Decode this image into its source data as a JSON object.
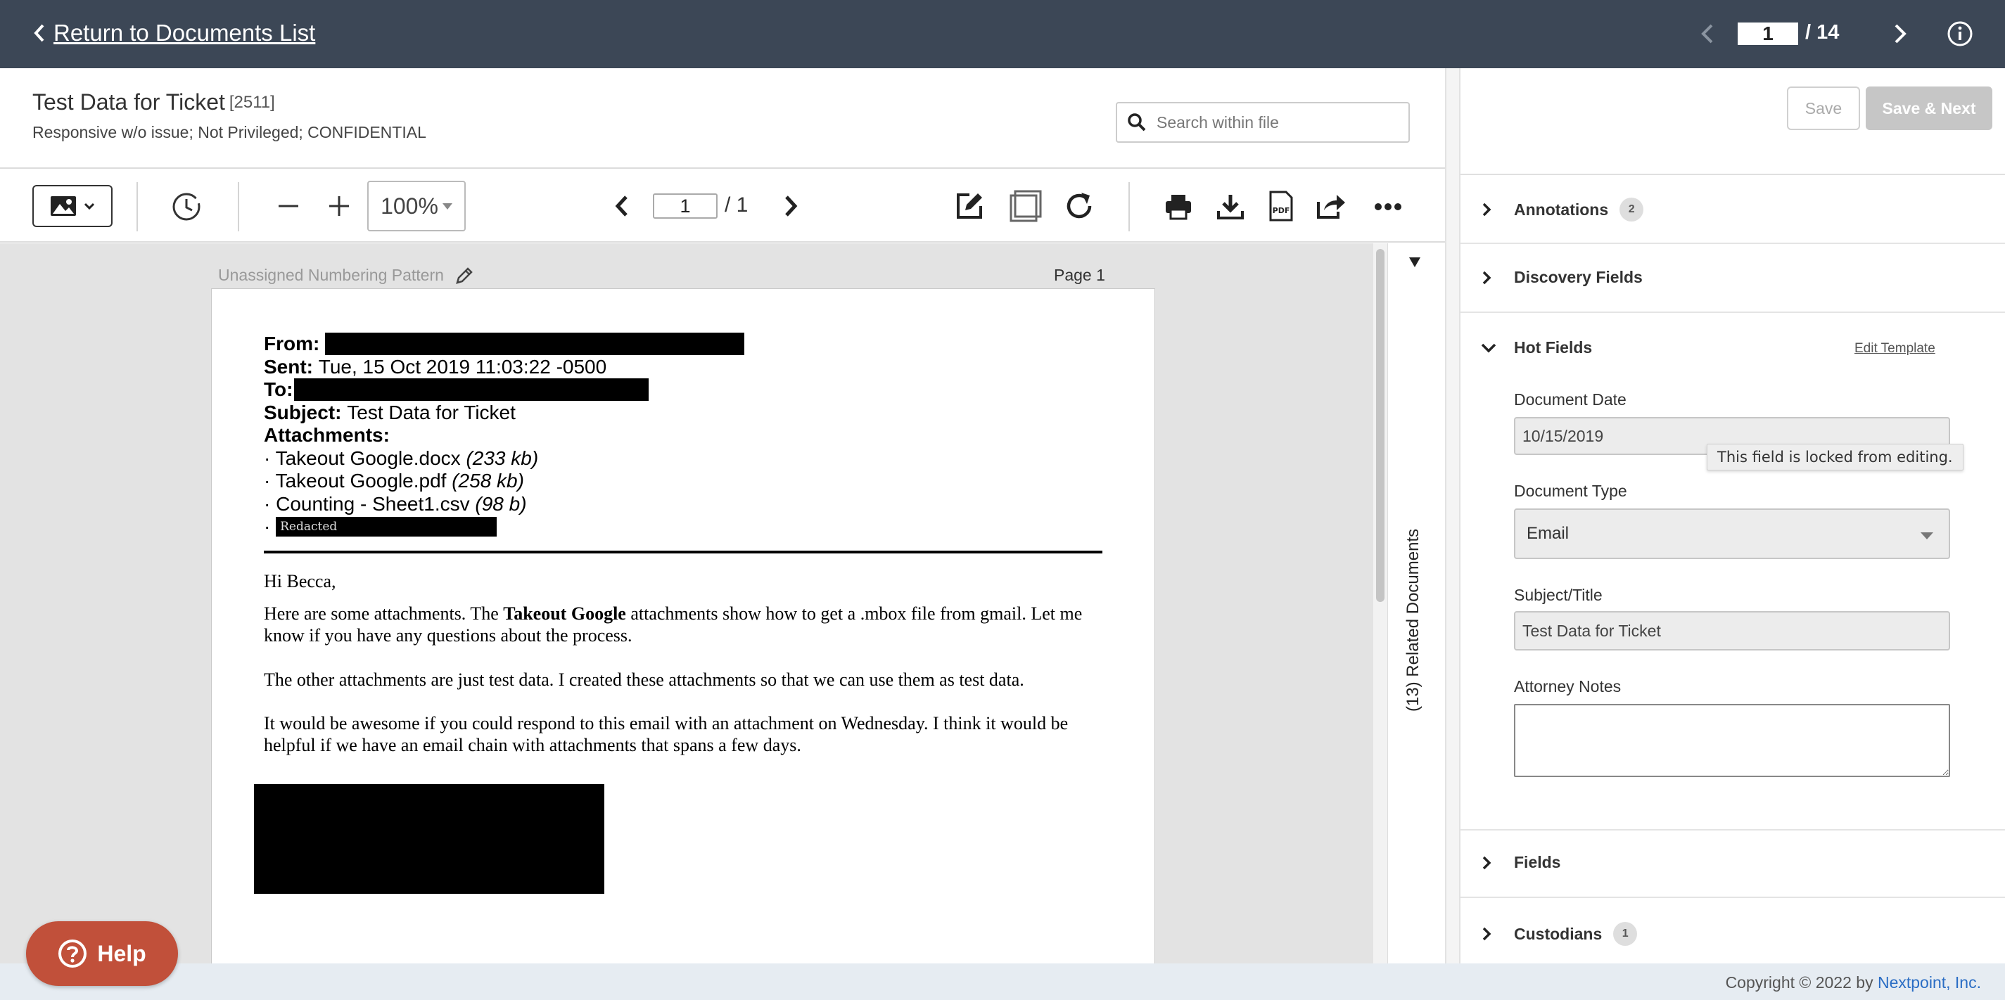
{
  "topbar": {
    "back_label": "Return to Documents List",
    "doc_index": "1",
    "doc_total": "/ 14"
  },
  "header": {
    "title": "Test Data for Ticket",
    "doc_id": "[2511]",
    "subtitle": "Responsive w/o issue; Not Privileged; CONFIDENTIAL",
    "search_placeholder": "Search within file"
  },
  "toolbar": {
    "zoom": "100%",
    "page_current": "1",
    "page_total": "/ 1"
  },
  "viewer": {
    "numbering_pattern": "Unassigned Numbering Pattern",
    "page_label": "Page 1",
    "related_documents": "(13) Related Documents"
  },
  "email": {
    "from_label": "From:",
    "sent_label": "Sent:",
    "sent_value": "Tue, 15 Oct 2019 11:03:22 -0500",
    "to_label": "To:",
    "subject_label": "Subject:",
    "subject_value": "Test Data for Ticket",
    "attachments_label": "Attachments:",
    "attachments": [
      {
        "name": "· Takeout Google.docx",
        "size": "(233 kb)"
      },
      {
        "name": "· Takeout Google.pdf",
        "size": "(258 kb)"
      },
      {
        "name": "· Counting - Sheet1.csv",
        "size": "(98 b)"
      }
    ],
    "redacted_bullet": "·",
    "redacted_text": "Redacted",
    "greeting": "Hi Becca,",
    "para1_a": "Here are some attachments. The ",
    "para1_b": "Takeout Google",
    "para1_c": " attachments show how to get a .mbox file from gmail. Let me know if you have any questions about the process.",
    "para2": "The other attachments are just test data. I created these attachments so that we can use them as test data.",
    "para3": "It would be awesome if you could respond to this email with an attachment on Wednesday. I think it would be helpful if we have an email chain with attachments that spans a few days."
  },
  "panel": {
    "save_label": "Save",
    "save_next_label": "Save & Next",
    "sections": {
      "annotations": {
        "label": "Annotations",
        "count": "2"
      },
      "discovery": {
        "label": "Discovery Fields"
      },
      "hot": {
        "label": "Hot Fields",
        "edit_label": "Edit Template"
      },
      "fields": {
        "label": "Fields"
      },
      "custodians": {
        "label": "Custodians",
        "count": "1"
      }
    },
    "hot_fields": {
      "document_date_label": "Document Date",
      "document_date_value": "10/15/2019",
      "locked_tooltip": "This field is locked from editing.",
      "document_type_label": "Document Type",
      "document_type_value": "Email",
      "subject_label": "Subject/Title",
      "subject_value": "Test Data for Ticket",
      "attorney_notes_label": "Attorney Notes",
      "attorney_notes_value": ""
    }
  },
  "footer": {
    "copyright": "Copyright © 2022 by ",
    "company": "Nextpoint, Inc."
  },
  "help": {
    "label": "Help"
  },
  "colors": {
    "topbar": "#3c4756",
    "help_button": "#c1503a",
    "link": "#2a6dc4",
    "viewer_bg": "#e3e3e3"
  }
}
